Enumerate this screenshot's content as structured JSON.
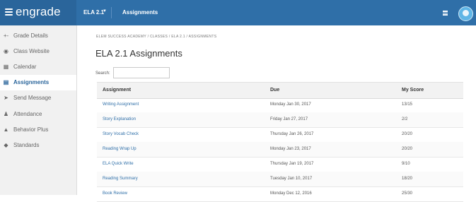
{
  "topbar": {
    "brand": "engrade",
    "class_selector": "ELA 2.1",
    "section": "Assignments"
  },
  "sidebar": {
    "items": [
      {
        "label": "Grade Details",
        "icon": "grade-details-icon",
        "glyph": "+-"
      },
      {
        "label": "Class Website",
        "icon": "globe-icon",
        "glyph": "◉"
      },
      {
        "label": "Calendar",
        "icon": "calendar-icon",
        "glyph": "▦"
      },
      {
        "label": "Assignments",
        "icon": "assignments-icon",
        "glyph": "▤"
      },
      {
        "label": "Send Message",
        "icon": "send-icon",
        "glyph": "➤"
      },
      {
        "label": "Attendance",
        "icon": "attendance-icon",
        "glyph": "♟"
      },
      {
        "label": "Behavior Plus",
        "icon": "warning-icon",
        "glyph": "▲"
      },
      {
        "label": "Standards",
        "icon": "tag-icon",
        "glyph": "◆"
      }
    ],
    "active_index": 3
  },
  "main": {
    "breadcrumb": "ELEM SUCCESS ACADEMY  /  CLASSES  /  ELA 2.1  /  ASSIGNMENTS",
    "title": "ELA 2.1 Assignments",
    "search_label": "Search:",
    "search_value": ""
  },
  "table": {
    "headers": [
      "Assignment",
      "Due",
      "My Score"
    ],
    "rows": [
      {
        "assignment": "Writing Assignment",
        "due": "Monday Jan 30, 2017",
        "score": "13/15"
      },
      {
        "assignment": "Story Explanation",
        "due": "Friday Jan 27, 2017",
        "score": "2/2"
      },
      {
        "assignment": "Story Vocab Check",
        "due": "Thursday Jan 26, 2017",
        "score": "20/20"
      },
      {
        "assignment": "Reading Wrap Up",
        "due": "Monday Jan 23, 2017",
        "score": "20/20"
      },
      {
        "assignment": "ELA Quick Write",
        "due": "Thursday Jan 19, 2017",
        "score": "9/10"
      },
      {
        "assignment": "Reading Summary",
        "due": "Tuesday Jan 10, 2017",
        "score": "18/20"
      },
      {
        "assignment": "Book Review",
        "due": "Monday Dec 12, 2016",
        "score": "25/30"
      }
    ]
  },
  "colors": {
    "topbar": "#2f6fa8",
    "brand_bg": "#2a659b",
    "link": "#2f6fa8",
    "sidebar_bg": "#f1f1f1"
  }
}
